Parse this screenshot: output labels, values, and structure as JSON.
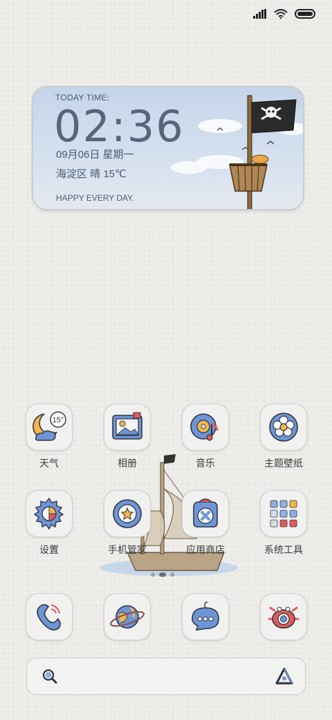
{
  "status_bar": {
    "signal": "signal-icon",
    "wifi": "wifi-icon",
    "battery": "battery-icon"
  },
  "widget": {
    "label": "TODAY TIME:",
    "time": "02:36",
    "date": "09月06日  星期一",
    "weather": "海淀区  晴  15℃",
    "footer": "HAPPY EVERY DAY."
  },
  "apps_row1": [
    {
      "label": "天气",
      "icon": "weather-icon",
      "temp": "15°"
    },
    {
      "label": "相册",
      "icon": "gallery-icon"
    },
    {
      "label": "音乐",
      "icon": "music-icon"
    },
    {
      "label": "主题壁纸",
      "icon": "themes-icon"
    }
  ],
  "apps_row2": [
    {
      "label": "设置",
      "icon": "settings-icon"
    },
    {
      "label": "手机管家",
      "icon": "security-icon"
    },
    {
      "label": "应用商店",
      "icon": "app-store-icon"
    },
    {
      "label": "系统工具",
      "icon": "tools-folder-icon"
    }
  ],
  "dock": [
    {
      "icon": "phone-icon"
    },
    {
      "icon": "browser-icon"
    },
    {
      "icon": "messages-icon"
    },
    {
      "icon": "camera-icon"
    }
  ],
  "colors": {
    "accent": "#4f86d6",
    "ink": "#2f3440",
    "background": "#ecebe8"
  }
}
